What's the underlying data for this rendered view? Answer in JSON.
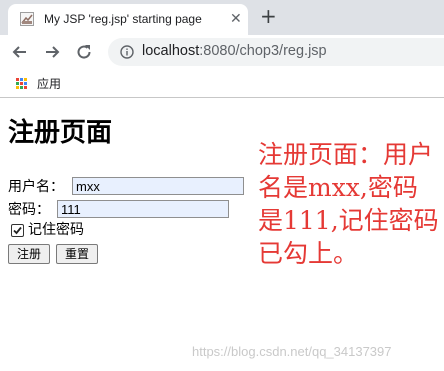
{
  "browser": {
    "tab": {
      "title": "My JSP 'reg.jsp' starting page",
      "close_glyph": "✕",
      "favicon": "page-favicon-icon"
    },
    "new_tab_glyph": "+",
    "address": {
      "host": "localhost",
      "rest": ":8080/chop3/reg.jsp"
    },
    "bookmarks": {
      "apps_label": "应用"
    }
  },
  "page": {
    "title": "注册页面",
    "username_label": "用户名：",
    "username_value": "mxx",
    "password_label": "密码：",
    "password_value": "111",
    "remember_label": "记住密码",
    "remember_checked": true,
    "submit_label": "注册",
    "reset_label": "重置"
  },
  "annotation": {
    "text": "注册页面：用户名是mxx,密码是111,记住密码已勾上。",
    "color": "#e53935"
  },
  "watermark": "https://blog.csdn.net/qq_34137397"
}
